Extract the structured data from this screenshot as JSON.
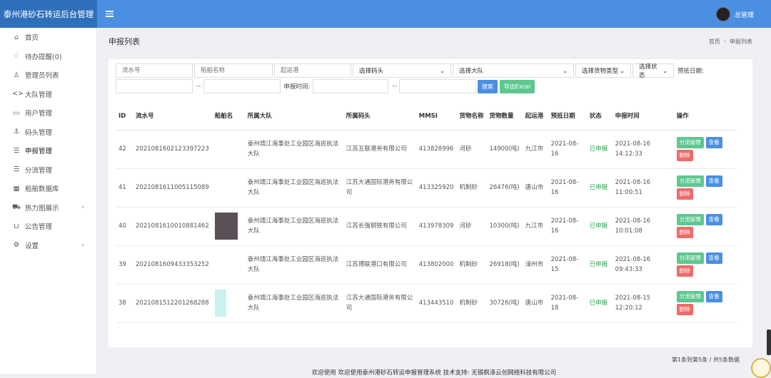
{
  "app": {
    "title": "泰州港砂石转运后台管理",
    "user": "总管理"
  },
  "sidebar": {
    "items": [
      {
        "label": "首页",
        "icon": "home-icon"
      },
      {
        "label": "待办提醒(0)",
        "icon": "bell-icon"
      },
      {
        "label": "管理员列表",
        "icon": "user-icon"
      },
      {
        "label": "大队管理",
        "icon": "code-icon"
      },
      {
        "label": "用户管理",
        "icon": "id-card-icon"
      },
      {
        "label": "码头管理",
        "icon": "anchor-icon"
      },
      {
        "label": "申报管理",
        "icon": "list-icon"
      },
      {
        "label": "分流管理",
        "icon": "list-icon"
      },
      {
        "label": "船舶数据库",
        "icon": "calendar-icon"
      },
      {
        "label": "热力图展示",
        "icon": "car-icon"
      },
      {
        "label": "公告管理",
        "icon": "basket-icon"
      },
      {
        "label": "设置",
        "icon": "gear-icon"
      }
    ]
  },
  "page": {
    "title": "申报列表",
    "breadcrumb": [
      "首页",
      "申报列表"
    ]
  },
  "filters": {
    "serial_placeholder": "流水号",
    "ship_name_placeholder": "船舶名称",
    "origin_port_placeholder": "起运港",
    "dock_select": "选择码头",
    "team_select": "选择大队",
    "cargo_select": "选择货物类型",
    "status_select": "选择状态",
    "arrival_label": "预抵日期:",
    "declare_label": "申报时间:",
    "search_button": "搜索",
    "export_button": "导出Excel"
  },
  "table": {
    "headers": [
      "ID",
      "流水号",
      "船舶名",
      "所属大队",
      "所属码头",
      "MMSI",
      "货物名称",
      "货物数量",
      "起运港",
      "预抵日期",
      "状态",
      "申报时间",
      "操作"
    ],
    "rows": [
      {
        "id": "42",
        "serial": "2021081602123397223",
        "team": "泰州靖江海事处工业园区海巡执法大队",
        "dock": "江苏五联港务有限公司",
        "mmsi": "413828996",
        "cargo": "河砂",
        "qty": "14900(吨)",
        "origin": "九江市",
        "arrival": "2021-08-16",
        "status": "已申报",
        "time": "2021-08-16 14:12:33"
      },
      {
        "id": "41",
        "serial": "2021081611005115089",
        "team": "泰州靖江海事处工业园区海巡执法大队",
        "dock": "江苏大通国际港务有限公司",
        "mmsi": "413325920",
        "cargo": "机制砂",
        "qty": "26476(吨)",
        "origin": "唐山市",
        "arrival": "2021-08-16",
        "status": "已申报",
        "time": "2021-08-16 11:00:51"
      },
      {
        "id": "40",
        "serial": "2021081610010881462",
        "team": "泰州靖江海事处工业园区海巡执法大队",
        "dock": "江苏长强钢铁有限公司",
        "mmsi": "413978309",
        "cargo": "河砂",
        "qty": "10300(吨)",
        "origin": "九江市",
        "arrival": "2021-08-16",
        "status": "已申报",
        "time": "2021-08-16 10:01:08"
      },
      {
        "id": "39",
        "serial": "2021081609433353252",
        "team": "泰州靖江海事处工业园区海巡执法大队",
        "dock": "江苏博联港口有限公司",
        "mmsi": "413802000",
        "cargo": "机制砂",
        "qty": "26918(吨)",
        "origin": "漳州市",
        "arrival": "2021-08-15",
        "status": "已申报",
        "time": "2021-08-16 09:43:33"
      },
      {
        "id": "38",
        "serial": "2021081512201268288",
        "team": "泰州靖江海事处工业园区海巡执法大队",
        "dock": "江苏大通国际港务有限公司",
        "mmsi": "413443510",
        "cargo": "机制砂",
        "qty": "30726(吨)",
        "origin": "唐山市",
        "arrival": "2021-08-18",
        "status": "已申报",
        "time": "2021-08-15 12:20:12"
      }
    ],
    "actions": {
      "divert": "分流管理",
      "view": "查看",
      "delete": "删除"
    }
  },
  "pagination": "第1条到第5条 / 共5条数据",
  "footer": "欢迎使用 欢迎使用泰州港砂石转运申报管理系统 技术支持: 无锡枫泽云创网络科技有限公司"
}
